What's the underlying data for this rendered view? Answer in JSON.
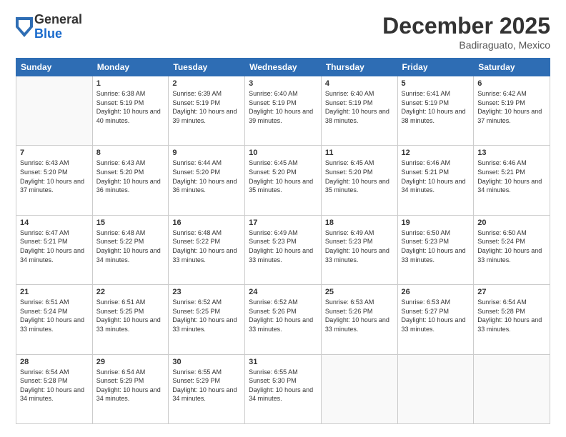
{
  "logo": {
    "general": "General",
    "blue": "Blue"
  },
  "title": "December 2025",
  "location": "Badiraguato, Mexico",
  "days_of_week": [
    "Sunday",
    "Monday",
    "Tuesday",
    "Wednesday",
    "Thursday",
    "Friday",
    "Saturday"
  ],
  "weeks": [
    [
      {
        "num": "",
        "sunrise": "",
        "sunset": "",
        "daylight": ""
      },
      {
        "num": "1",
        "sunrise": "Sunrise: 6:38 AM",
        "sunset": "Sunset: 5:19 PM",
        "daylight": "Daylight: 10 hours and 40 minutes."
      },
      {
        "num": "2",
        "sunrise": "Sunrise: 6:39 AM",
        "sunset": "Sunset: 5:19 PM",
        "daylight": "Daylight: 10 hours and 39 minutes."
      },
      {
        "num": "3",
        "sunrise": "Sunrise: 6:40 AM",
        "sunset": "Sunset: 5:19 PM",
        "daylight": "Daylight: 10 hours and 39 minutes."
      },
      {
        "num": "4",
        "sunrise": "Sunrise: 6:40 AM",
        "sunset": "Sunset: 5:19 PM",
        "daylight": "Daylight: 10 hours and 38 minutes."
      },
      {
        "num": "5",
        "sunrise": "Sunrise: 6:41 AM",
        "sunset": "Sunset: 5:19 PM",
        "daylight": "Daylight: 10 hours and 38 minutes."
      },
      {
        "num": "6",
        "sunrise": "Sunrise: 6:42 AM",
        "sunset": "Sunset: 5:19 PM",
        "daylight": "Daylight: 10 hours and 37 minutes."
      }
    ],
    [
      {
        "num": "7",
        "sunrise": "Sunrise: 6:43 AM",
        "sunset": "Sunset: 5:20 PM",
        "daylight": "Daylight: 10 hours and 37 minutes."
      },
      {
        "num": "8",
        "sunrise": "Sunrise: 6:43 AM",
        "sunset": "Sunset: 5:20 PM",
        "daylight": "Daylight: 10 hours and 36 minutes."
      },
      {
        "num": "9",
        "sunrise": "Sunrise: 6:44 AM",
        "sunset": "Sunset: 5:20 PM",
        "daylight": "Daylight: 10 hours and 36 minutes."
      },
      {
        "num": "10",
        "sunrise": "Sunrise: 6:45 AM",
        "sunset": "Sunset: 5:20 PM",
        "daylight": "Daylight: 10 hours and 35 minutes."
      },
      {
        "num": "11",
        "sunrise": "Sunrise: 6:45 AM",
        "sunset": "Sunset: 5:20 PM",
        "daylight": "Daylight: 10 hours and 35 minutes."
      },
      {
        "num": "12",
        "sunrise": "Sunrise: 6:46 AM",
        "sunset": "Sunset: 5:21 PM",
        "daylight": "Daylight: 10 hours and 34 minutes."
      },
      {
        "num": "13",
        "sunrise": "Sunrise: 6:46 AM",
        "sunset": "Sunset: 5:21 PM",
        "daylight": "Daylight: 10 hours and 34 minutes."
      }
    ],
    [
      {
        "num": "14",
        "sunrise": "Sunrise: 6:47 AM",
        "sunset": "Sunset: 5:21 PM",
        "daylight": "Daylight: 10 hours and 34 minutes."
      },
      {
        "num": "15",
        "sunrise": "Sunrise: 6:48 AM",
        "sunset": "Sunset: 5:22 PM",
        "daylight": "Daylight: 10 hours and 34 minutes."
      },
      {
        "num": "16",
        "sunrise": "Sunrise: 6:48 AM",
        "sunset": "Sunset: 5:22 PM",
        "daylight": "Daylight: 10 hours and 33 minutes."
      },
      {
        "num": "17",
        "sunrise": "Sunrise: 6:49 AM",
        "sunset": "Sunset: 5:23 PM",
        "daylight": "Daylight: 10 hours and 33 minutes."
      },
      {
        "num": "18",
        "sunrise": "Sunrise: 6:49 AM",
        "sunset": "Sunset: 5:23 PM",
        "daylight": "Daylight: 10 hours and 33 minutes."
      },
      {
        "num": "19",
        "sunrise": "Sunrise: 6:50 AM",
        "sunset": "Sunset: 5:23 PM",
        "daylight": "Daylight: 10 hours and 33 minutes."
      },
      {
        "num": "20",
        "sunrise": "Sunrise: 6:50 AM",
        "sunset": "Sunset: 5:24 PM",
        "daylight": "Daylight: 10 hours and 33 minutes."
      }
    ],
    [
      {
        "num": "21",
        "sunrise": "Sunrise: 6:51 AM",
        "sunset": "Sunset: 5:24 PM",
        "daylight": "Daylight: 10 hours and 33 minutes."
      },
      {
        "num": "22",
        "sunrise": "Sunrise: 6:51 AM",
        "sunset": "Sunset: 5:25 PM",
        "daylight": "Daylight: 10 hours and 33 minutes."
      },
      {
        "num": "23",
        "sunrise": "Sunrise: 6:52 AM",
        "sunset": "Sunset: 5:25 PM",
        "daylight": "Daylight: 10 hours and 33 minutes."
      },
      {
        "num": "24",
        "sunrise": "Sunrise: 6:52 AM",
        "sunset": "Sunset: 5:26 PM",
        "daylight": "Daylight: 10 hours and 33 minutes."
      },
      {
        "num": "25",
        "sunrise": "Sunrise: 6:53 AM",
        "sunset": "Sunset: 5:26 PM",
        "daylight": "Daylight: 10 hours and 33 minutes."
      },
      {
        "num": "26",
        "sunrise": "Sunrise: 6:53 AM",
        "sunset": "Sunset: 5:27 PM",
        "daylight": "Daylight: 10 hours and 33 minutes."
      },
      {
        "num": "27",
        "sunrise": "Sunrise: 6:54 AM",
        "sunset": "Sunset: 5:28 PM",
        "daylight": "Daylight: 10 hours and 33 minutes."
      }
    ],
    [
      {
        "num": "28",
        "sunrise": "Sunrise: 6:54 AM",
        "sunset": "Sunset: 5:28 PM",
        "daylight": "Daylight: 10 hours and 34 minutes."
      },
      {
        "num": "29",
        "sunrise": "Sunrise: 6:54 AM",
        "sunset": "Sunset: 5:29 PM",
        "daylight": "Daylight: 10 hours and 34 minutes."
      },
      {
        "num": "30",
        "sunrise": "Sunrise: 6:55 AM",
        "sunset": "Sunset: 5:29 PM",
        "daylight": "Daylight: 10 hours and 34 minutes."
      },
      {
        "num": "31",
        "sunrise": "Sunrise: 6:55 AM",
        "sunset": "Sunset: 5:30 PM",
        "daylight": "Daylight: 10 hours and 34 minutes."
      },
      {
        "num": "",
        "sunrise": "",
        "sunset": "",
        "daylight": ""
      },
      {
        "num": "",
        "sunrise": "",
        "sunset": "",
        "daylight": ""
      },
      {
        "num": "",
        "sunrise": "",
        "sunset": "",
        "daylight": ""
      }
    ]
  ]
}
